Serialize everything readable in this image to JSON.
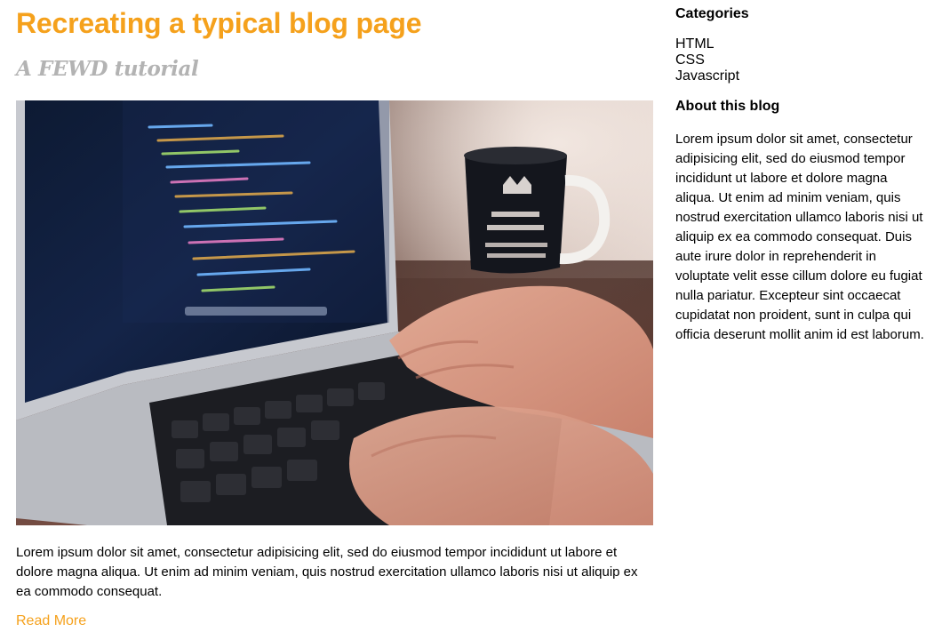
{
  "post": {
    "title": "Recreating a typical blog page",
    "subtitle": "A FEWD tutorial",
    "image_icon": "laptop-coding-photo",
    "body": "Lorem ipsum dolor sit amet, consectetur adipisicing elit, sed do eiusmod tempor incididunt ut labore et dolore magna aliqua. Ut enim ad minim veniam, quis nostrud exercitation ullamco laboris nisi ut aliquip ex ea commodo consequat.",
    "read_more": "Read More"
  },
  "sidebar": {
    "categories_heading": "Categories",
    "categories": [
      "HTML",
      "CSS",
      "Javascript"
    ],
    "about_heading": "About this blog",
    "about_text": "Lorem ipsum dolor sit amet, consectetur adipisicing elit, sed do eiusmod tempor incididunt ut labore et dolore magna aliqua. Ut enim ad minim veniam, quis nostrud exercitation ullamco laboris nisi ut aliquip ex ea commodo consequat. Duis aute irure dolor in reprehenderit in voluptate velit esse cillum dolore eu fugiat nulla pariatur. Excepteur sint occaecat cupidatat non proident, sunt in culpa qui officia deserunt mollit anim id est laborum."
  },
  "colors": {
    "accent": "#f5a11c",
    "subtitle": "#b3b3b3",
    "text": "#000000"
  }
}
